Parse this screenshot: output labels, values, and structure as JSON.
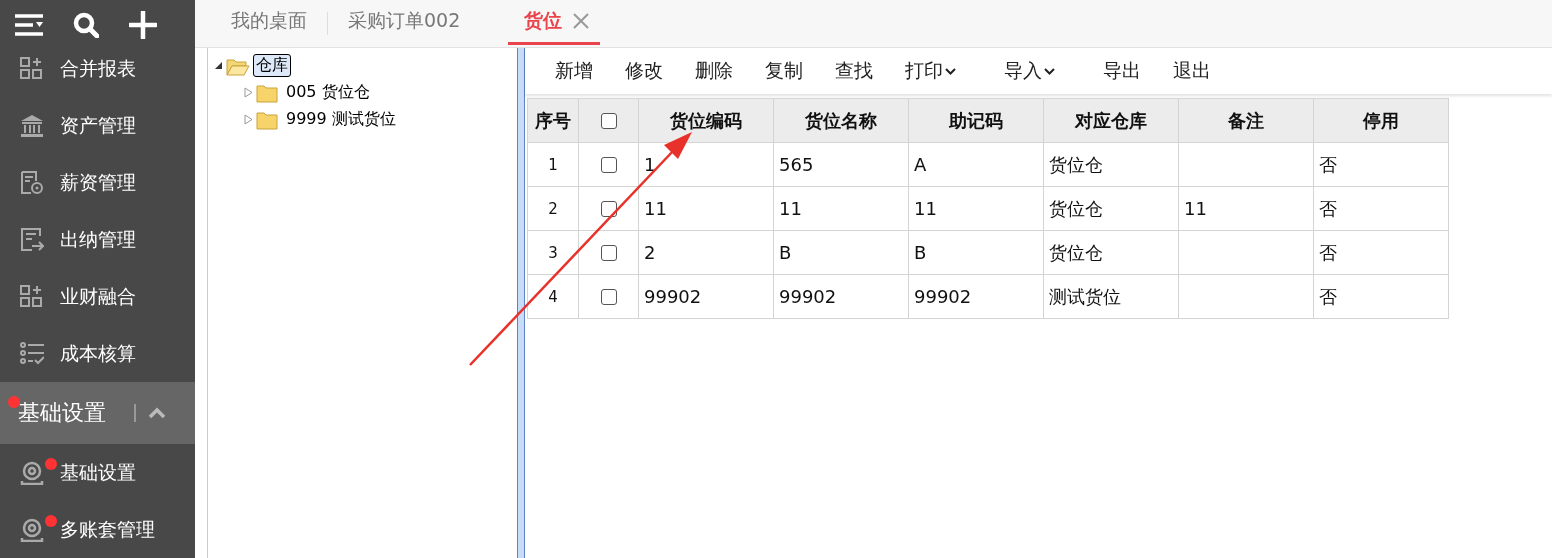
{
  "sidebar": {
    "items": [
      {
        "label": "合并报表",
        "dot": false
      },
      {
        "label": "资产管理",
        "dot": false
      },
      {
        "label": "薪资管理",
        "dot": false
      },
      {
        "label": "出纳管理",
        "dot": false
      },
      {
        "label": "业财融合",
        "dot": false
      },
      {
        "label": "成本核算",
        "dot": false
      }
    ],
    "section": {
      "label": "基础设置",
      "dot": true,
      "expanded": true,
      "items": [
        {
          "label": "基础设置",
          "dot": true
        },
        {
          "label": "多账套管理",
          "dot": true
        }
      ]
    }
  },
  "tabs": [
    {
      "label": "我的桌面",
      "selected": false,
      "closable": false
    },
    {
      "label": "采购订单002",
      "selected": false,
      "closable": false
    },
    {
      "label": "货位",
      "selected": true,
      "closable": true
    }
  ],
  "tree": {
    "label": "仓库",
    "expanded": true,
    "selected": true,
    "children": [
      {
        "label": "005 货位仓",
        "expanded": false,
        "selected": false
      },
      {
        "label": "9999 测试货位",
        "expanded": false,
        "selected": false
      }
    ]
  },
  "toolbar": [
    {
      "label": "新增",
      "dropdown": false
    },
    {
      "label": "修改",
      "dropdown": false
    },
    {
      "label": "删除",
      "dropdown": false
    },
    {
      "label": "复制",
      "dropdown": false
    },
    {
      "label": "查找",
      "dropdown": false
    },
    {
      "label": "打印",
      "dropdown": true
    },
    {
      "label": "导入",
      "dropdown": true
    },
    {
      "label": "导出",
      "dropdown": false
    },
    {
      "label": "退出",
      "dropdown": false
    }
  ],
  "table": {
    "index_label": "序号",
    "header_checked": false,
    "columns": [
      "货位编码",
      "货位名称",
      "助记码",
      "对应仓库",
      "备注",
      "停用"
    ],
    "rows": [
      {
        "index": "1",
        "checked": false,
        "cells": [
          "1",
          "565",
          "A",
          "货位仓",
          null,
          "否"
        ]
      },
      {
        "index": "2",
        "checked": false,
        "cells": [
          "11",
          "11",
          "11",
          "货位仓",
          "11",
          "否"
        ]
      },
      {
        "index": "3",
        "checked": false,
        "cells": [
          "2",
          "B",
          "B",
          "货位仓",
          null,
          "否"
        ]
      },
      {
        "index": "4",
        "checked": false,
        "cells": [
          "99902",
          "99902",
          "99902",
          "测试货位",
          null,
          "否"
        ]
      }
    ]
  }
}
